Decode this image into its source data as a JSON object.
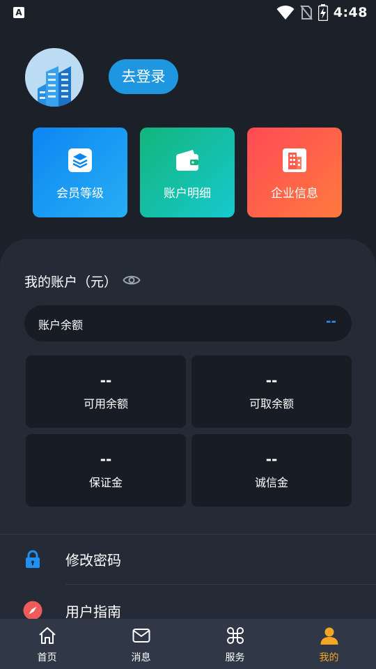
{
  "status_bar": {
    "time": "4:48",
    "app_badge": "A",
    "icons": [
      "wifi-icon",
      "no-sim-icon",
      "battery-charging-icon"
    ]
  },
  "header": {
    "avatar": "building-avatar",
    "login_label": "去登录"
  },
  "shortcuts": [
    {
      "label": "会员等级",
      "icon": "layers-icon",
      "color_from": "#0d86f2",
      "color_to": "#27aef5"
    },
    {
      "label": "账户明细",
      "icon": "wallet-icon",
      "color_from": "#12b57b",
      "color_to": "#17c9cf"
    },
    {
      "label": "企业信息",
      "icon": "building-icon",
      "color_from": "#ff4a55",
      "color_to": "#ff7a3e"
    }
  ],
  "account": {
    "title": "我的账户（元）",
    "balance_label": "账户余额",
    "balance_value": "--",
    "stats": [
      {
        "value": "--",
        "label": "可用余额"
      },
      {
        "value": "--",
        "label": "可取余额"
      },
      {
        "value": "--",
        "label": "保证金"
      },
      {
        "value": "--",
        "label": "诚信金"
      }
    ]
  },
  "menu": [
    {
      "label": "修改密码",
      "icon": "lock-icon",
      "color": "#1f8ff0"
    },
    {
      "label": "用户指南",
      "icon": "compass-icon",
      "color": "#f05a5a"
    }
  ],
  "bottom_nav": [
    {
      "label": "首页",
      "icon": "home-icon",
      "active": false
    },
    {
      "label": "消息",
      "icon": "mail-icon",
      "active": false
    },
    {
      "label": "服务",
      "icon": "command-icon",
      "active": false
    },
    {
      "label": "我的",
      "icon": "person-icon",
      "active": true
    }
  ],
  "colors": {
    "background": "#1b2029",
    "panel": "#242b37",
    "accent_blue": "#1f96e0",
    "active_nav": "#f5a623"
  }
}
